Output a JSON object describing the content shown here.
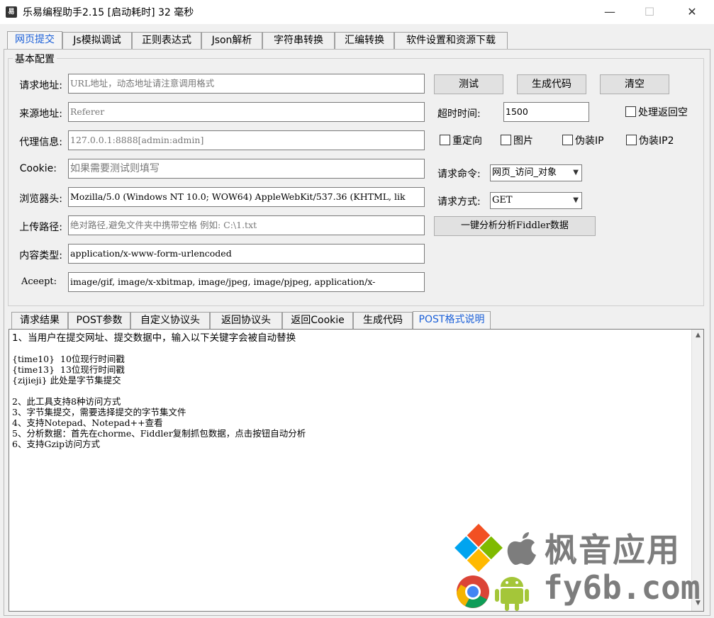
{
  "window": {
    "title": "乐易编程助手2.15 [启动耗时] 32 毫秒",
    "icon": "app-logo-icon",
    "controls": {
      "minimize": "—",
      "maximize": "☐",
      "close": "✕"
    }
  },
  "top_tabs": [
    {
      "label": "网页提交",
      "active": true
    },
    {
      "label": "Js模拟调试",
      "active": false
    },
    {
      "label": "正则表达式",
      "active": false
    },
    {
      "label": "Json解析",
      "active": false
    },
    {
      "label": "字符串转换",
      "active": false
    },
    {
      "label": "汇编转换",
      "active": false
    },
    {
      "label": "软件设置和资源下载",
      "active": false
    }
  ],
  "config": {
    "group_title": "基本配置",
    "request_url": {
      "label": "请求地址:",
      "value": "",
      "placeholder": "URL地址，动态地址请注意调用格式"
    },
    "referer": {
      "label": "来源地址:",
      "value": "",
      "placeholder": "Referer"
    },
    "proxy": {
      "label": "代理信息:",
      "value": "",
      "placeholder": "127.0.0.1:8888[admin:admin]"
    },
    "cookie": {
      "label": "Cookie:",
      "value": "",
      "placeholder": "如果需要测试则填写"
    },
    "user_agent": {
      "label": "浏览器头:",
      "value": "Mozilla/5.0 (Windows NT 10.0; WOW64) AppleWebKit/537.36 (KHTML, lik"
    },
    "upload_path": {
      "label": "上传路径:",
      "value": "",
      "placeholder": "绝对路径,避免文件夹中携带空格 例如: C:\\1.txt"
    },
    "content_type": {
      "label": "内容类型:",
      "value": "application/x-www-form-urlencoded"
    },
    "accept": {
      "label": "Aceept:",
      "value": "image/gif, image/x-xbitmap, image/jpeg, image/pjpeg, application/x-"
    },
    "buttons": {
      "test": "测试",
      "generate": "生成代码",
      "clear": "清空",
      "analyze": "一键分析分析Fiddler数据"
    },
    "timeout": {
      "label": "超时时间:",
      "value": "1500"
    },
    "checkboxes": {
      "handle_empty": {
        "label": "处理返回空",
        "checked": false
      },
      "redirect": {
        "label": "重定向",
        "checked": false
      },
      "image": {
        "label": "图片",
        "checked": false
      },
      "fake_ip": {
        "label": "伪装IP",
        "checked": false
      },
      "fake_ip2": {
        "label": "伪装IP2",
        "checked": false
      }
    },
    "request_command": {
      "label": "请求命令:",
      "selected": "网页_访问_对象"
    },
    "request_method": {
      "label": "请求方式:",
      "selected": "GET"
    }
  },
  "bottom_tabs": [
    {
      "label": "请求结果",
      "active": false
    },
    {
      "label": "POST参数",
      "active": false
    },
    {
      "label": "自定义协议头",
      "active": false
    },
    {
      "label": "返回协议头",
      "active": false
    },
    {
      "label": "返回Cookie",
      "active": false
    },
    {
      "label": "生成代码",
      "active": false
    },
    {
      "label": "POST格式说明",
      "active": true
    }
  ],
  "description_lines": [
    "1、当用户在提交网址、提交数据中，输入以下关键字会被自动替换",
    "",
    "{time10}  10位现行时间戳",
    "{time13}  13位现行时间戳",
    "{zijieji} 此处是字节集提交",
    "",
    "2、此工具支持8种访问方式",
    "3、字节集提交，需要选择提交的字节集文件",
    "4、支持Notepad、Notepad++查看",
    "5、分析数据：首先在chorme、Fiddler复制抓包数据，点击按钮自动分析",
    "6、支持Gzip访问方式"
  ],
  "watermark": {
    "cn_text": "枫音应用",
    "domain": "fy6b.com"
  },
  "colors": {
    "active_tab": "#1a5fd8",
    "window_bg": "#f0f0f0"
  }
}
